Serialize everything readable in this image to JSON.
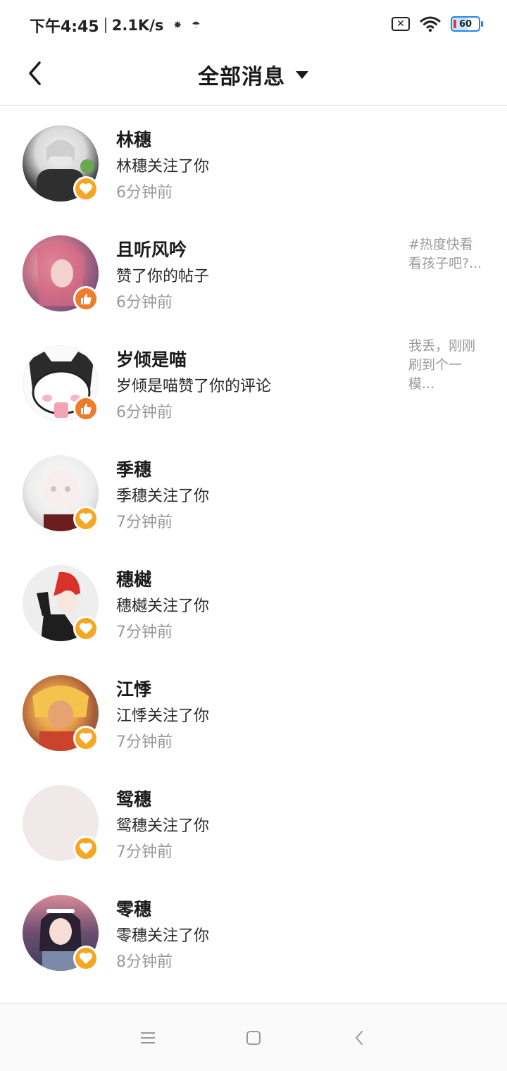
{
  "status_bar": {
    "time": "下午4:45",
    "speed": "2.1K/s",
    "battery": "60"
  },
  "header": {
    "title": "全部消息"
  },
  "messages": [
    {
      "name": "林穗",
      "action": "林穗关注了你",
      "time": "6分钟前",
      "badge": "heart",
      "preview": ""
    },
    {
      "name": "且听风吟",
      "action": "赞了你的帖子",
      "time": "6分钟前",
      "badge": "like",
      "preview": "#热度快看看孩子吧?..."
    },
    {
      "name": "岁倾是喵",
      "action": "岁倾是喵赞了你的评论",
      "time": "6分钟前",
      "badge": "like",
      "preview": "我丢，刚刚刷到个一模..."
    },
    {
      "name": "季穗",
      "action": "季穗关注了你",
      "time": "7分钟前",
      "badge": "heart",
      "preview": ""
    },
    {
      "name": "穗樾",
      "action": "穗樾关注了你",
      "time": "7分钟前",
      "badge": "heart",
      "preview": ""
    },
    {
      "name": "江悸",
      "action": "江悸关注了你",
      "time": "7分钟前",
      "badge": "heart",
      "preview": ""
    },
    {
      "name": "鸳穗",
      "action": "鸳穗关注了你",
      "time": "7分钟前",
      "badge": "heart",
      "preview": ""
    },
    {
      "name": "零穗",
      "action": "零穗关注了你",
      "time": "8分钟前",
      "badge": "heart",
      "preview": ""
    }
  ],
  "colors": {
    "heart_badge": "#f5a623",
    "like_badge": "#f07b2a",
    "time_text": "#9a9a9a"
  }
}
